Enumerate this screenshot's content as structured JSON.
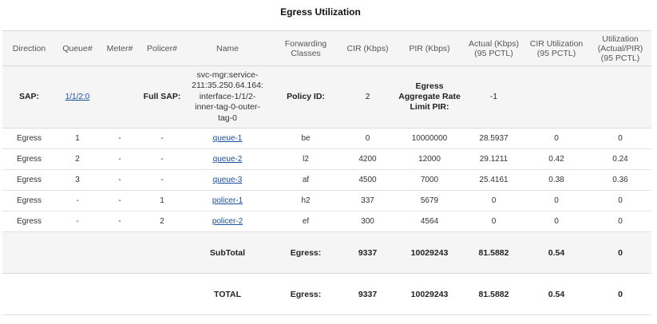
{
  "title": "Egress Utilization",
  "headers": [
    "Direction",
    "Queue#",
    "Meter#",
    "Policer#",
    "Name",
    "Forwarding Classes",
    "CIR (Kbps)",
    "PIR (Kbps)",
    "Actual (Kbps) (95 PCTL)",
    "CIR Utilization (95 PCTL)",
    "Utilization (Actual/PIR) (95 PCTL)"
  ],
  "sap": {
    "label": "SAP:",
    "value": "1/1/2:0",
    "full_sap_label": "Full SAP:",
    "full_sap_value": "svc-mgr:service-211:35.250.64.164:interface-1/1/2-inner-tag-0-outer-tag-0",
    "policy_label": "Policy ID:",
    "policy_value": "2",
    "egress_rate_label": "Egress Aggregate Rate Limit PIR:",
    "egress_rate_value": "-1"
  },
  "rows": [
    {
      "direction": "Egress",
      "queue": "1",
      "meter": "-",
      "policer": "-",
      "name": "queue-1",
      "fc": "be",
      "cir": "0",
      "pir": "10000000",
      "actual": "28.5937",
      "cir_util": "0",
      "util": "0"
    },
    {
      "direction": "Egress",
      "queue": "2",
      "meter": "-",
      "policer": "-",
      "name": "queue-2",
      "fc": "l2",
      "cir": "4200",
      "pir": "12000",
      "actual": "29.1211",
      "cir_util": "0.42",
      "util": "0.24"
    },
    {
      "direction": "Egress",
      "queue": "3",
      "meter": "-",
      "policer": "-",
      "name": "queue-3",
      "fc": "af",
      "cir": "4500",
      "pir": "7000",
      "actual": "25.4161",
      "cir_util": "0.38",
      "util": "0.36"
    },
    {
      "direction": "Egress",
      "queue": "-",
      "meter": "-",
      "policer": "1",
      "name": "policer-1",
      "fc": "h2",
      "cir": "337",
      "pir": "5679",
      "actual": "0",
      "cir_util": "0",
      "util": "0"
    },
    {
      "direction": "Egress",
      "queue": "-",
      "meter": "-",
      "policer": "2",
      "name": "policer-2",
      "fc": "ef",
      "cir": "300",
      "pir": "4564",
      "actual": "0",
      "cir_util": "0",
      "util": "0"
    }
  ],
  "subtotal": {
    "label": "SubTotal",
    "dir": "Egress:",
    "cir": "9337",
    "pir": "10029243",
    "actual": "81.5882",
    "cir_util": "0.54",
    "util": "0"
  },
  "total": {
    "label": "TOTAL",
    "dir": "Egress:",
    "cir": "9337",
    "pir": "10029243",
    "actual": "81.5882",
    "cir_util": "0.54",
    "util": "0"
  }
}
